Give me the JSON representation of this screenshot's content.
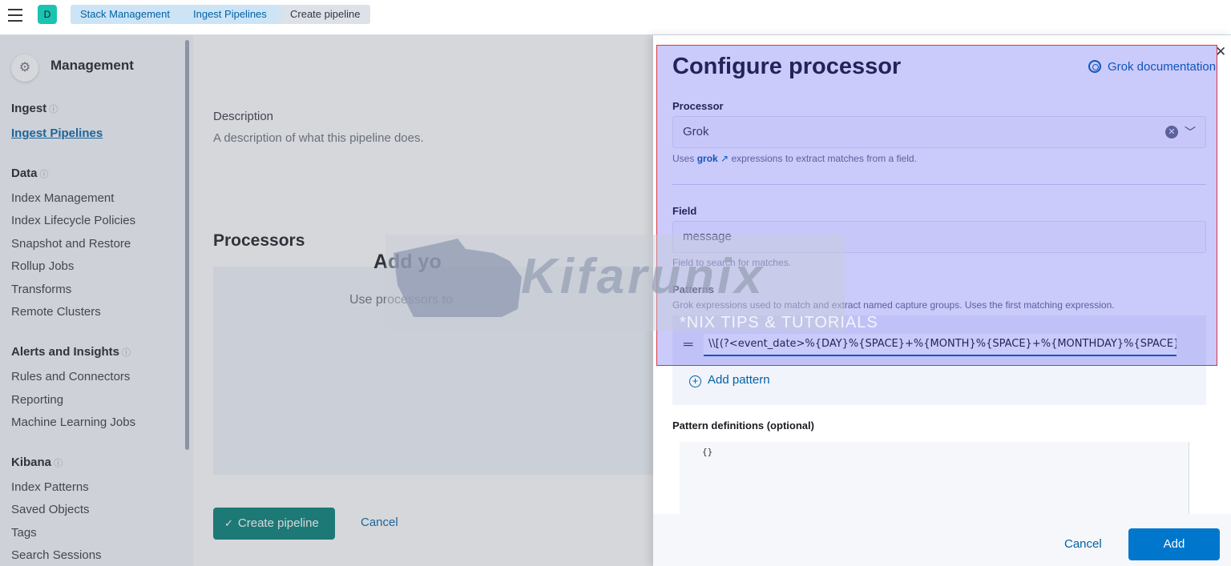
{
  "topbar": {
    "space_badge": "D",
    "breadcrumbs": [
      "Stack Management",
      "Ingest Pipelines",
      "Create pipeline"
    ]
  },
  "sidebar": {
    "title": "Management",
    "groups": [
      {
        "label": "Ingest",
        "items": [
          "Ingest Pipelines"
        ]
      },
      {
        "label": "Data",
        "items": [
          "Index Management",
          "Index Lifecycle Policies",
          "Snapshot and Restore",
          "Rollup Jobs",
          "Transforms",
          "Remote Clusters"
        ]
      },
      {
        "label": "Alerts and Insights",
        "items": [
          "Rules and Connectors",
          "Reporting",
          "Machine Learning Jobs"
        ]
      },
      {
        "label": "Kibana",
        "items": [
          "Index Patterns",
          "Saved Objects",
          "Tags",
          "Search Sessions"
        ]
      }
    ],
    "active_item": "Ingest Pipelines"
  },
  "main": {
    "description_label": "Description",
    "description_text": "A description of what this pipeline does.",
    "processors_title": "Processors",
    "empty_title": "Add yo",
    "empty_body": "Use processors to",
    "create_button": "Create pipeline",
    "cancel_button": "Cancel"
  },
  "flyout": {
    "title": "Configure processor",
    "doc_link": "Grok documentation",
    "processor_label": "Processor",
    "processor_value": "Grok",
    "processor_help_prefix": "Uses",
    "processor_help_link": "grok",
    "processor_help_suffix": "expressions to extract matches from a field.",
    "field_label": "Field",
    "field_value": "message",
    "field_help": "Field to search for matches.",
    "patterns_label": "Patterns",
    "patterns_help": "Grok expressions used to match and extract named capture groups. Uses the first matching expression.",
    "pattern_value": "\\\\[(?<event_date>%{DAY}%{SPACE}+%{MONTH}%{SPACE}+%{MONTHDAY}%{SPACE}+",
    "add_pattern": "Add pattern",
    "definitions_label": "Pattern definitions (optional)",
    "definitions_value": "{}",
    "cancel_button": "Cancel",
    "add_button": "Add"
  },
  "watermark": {
    "brand": "Kifarunix",
    "tagline": "*NIX TIPS & TUTORIALS"
  },
  "colors": {
    "primary": "#0077cc",
    "success": "#017d73",
    "highlight": "#e03040"
  }
}
